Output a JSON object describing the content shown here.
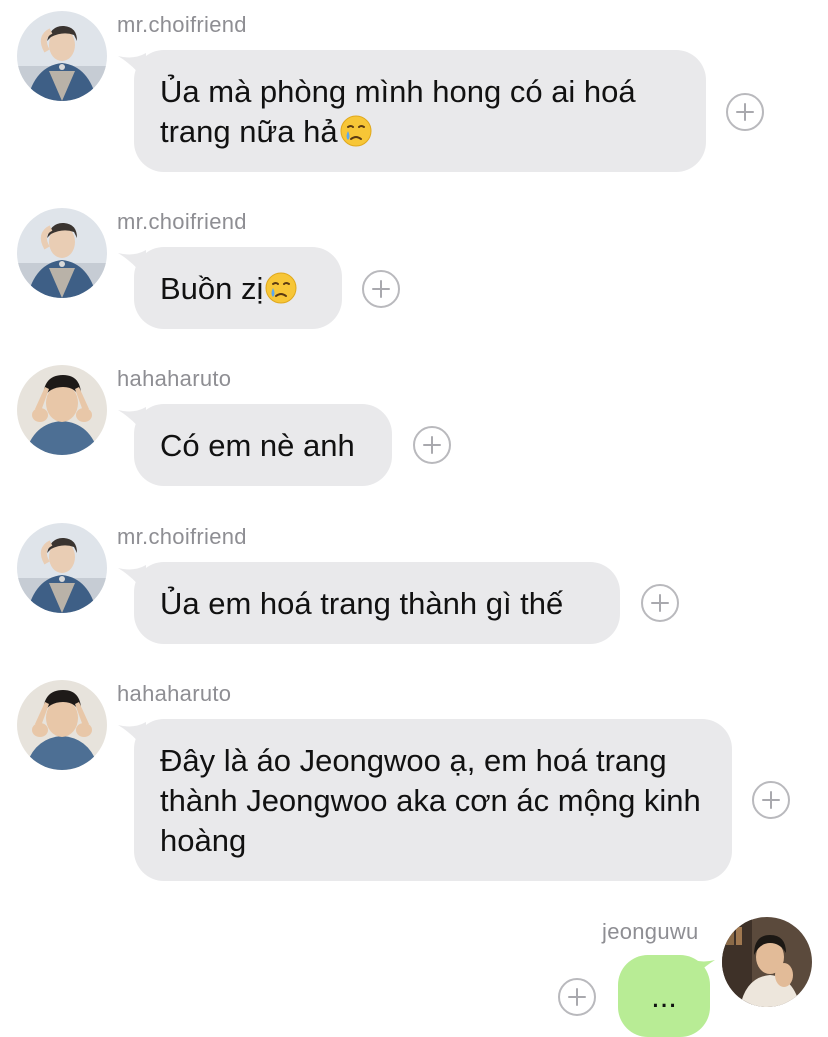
{
  "colors": {
    "incoming_bubble": "#e9e9eb",
    "outgoing_bubble": "#b8ec95",
    "username": "#8e8e93",
    "text": "#111111"
  },
  "messages": [
    {
      "sender": "mr.choifriend",
      "text": "Ủa mà phòng mình hong có ai hoá trang nữa hả",
      "emoji": "crying-face-emoji",
      "react_icon": "plus-circle-icon"
    },
    {
      "sender": "mr.choifriend",
      "text": "Buồn zị",
      "emoji": "crying-face-emoji",
      "react_icon": "plus-circle-icon"
    },
    {
      "sender": "hahaharuto",
      "text": "Có em nè anh",
      "react_icon": "plus-circle-icon"
    },
    {
      "sender": "mr.choifriend",
      "text": "Ủa em hoá trang thành gì thế",
      "react_icon": "plus-circle-icon"
    },
    {
      "sender": "hahaharuto",
      "text": "Đây là áo Jeongwoo ạ, em hoá trang thành Jeongwoo aka cơn ác mộng kinh hoàng",
      "react_icon": "plus-circle-icon"
    },
    {
      "sender": "jeonguwu",
      "text": "...",
      "react_icon": "plus-circle-icon"
    }
  ]
}
